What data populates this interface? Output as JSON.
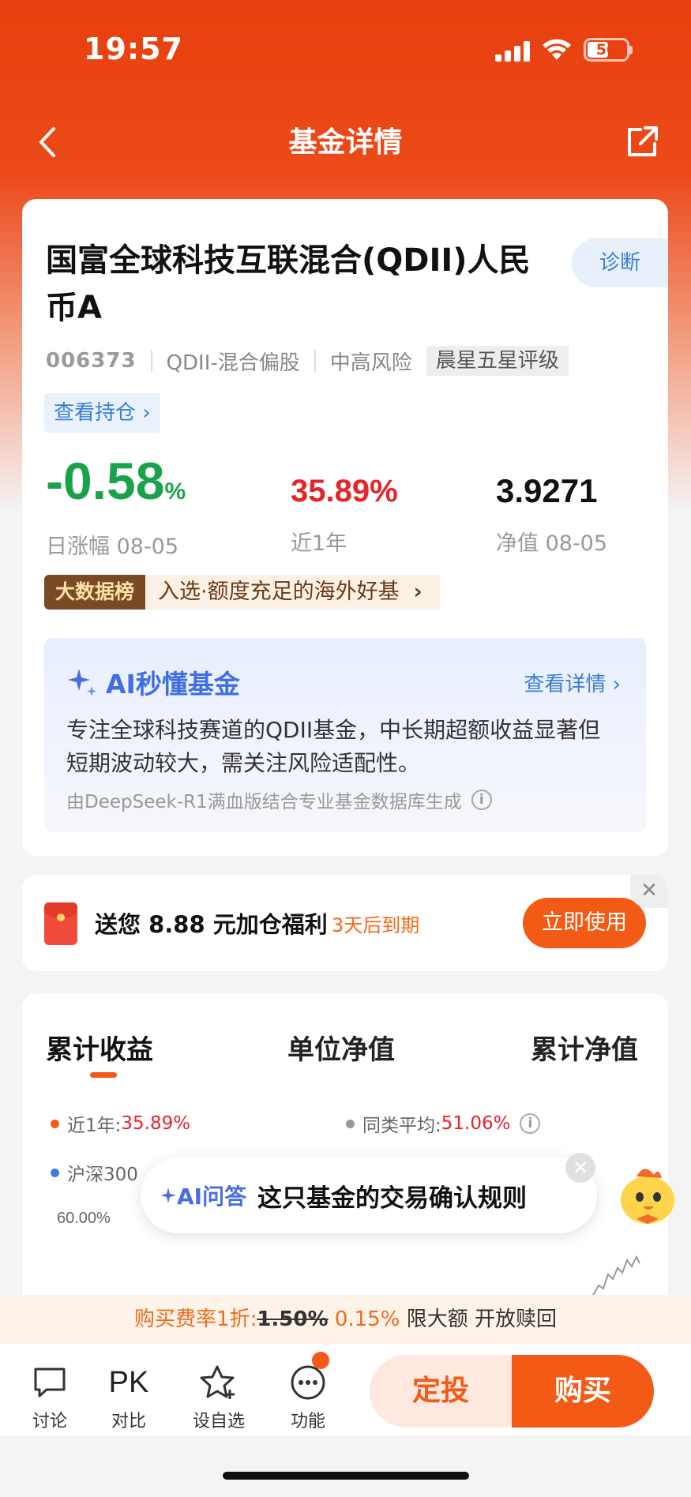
{
  "status_bar": {
    "time": "19:57",
    "battery": "50"
  },
  "nav": {
    "title": "基金详情"
  },
  "fund": {
    "name": "国富全球科技互联混合(QDII)人民币A",
    "diagnose_label": "诊断",
    "code": "006373",
    "type": "QDII-混合偏股",
    "risk": "中高风险",
    "rating": "晨星五星评级",
    "holdings_label": "查看持仓",
    "daily_change": {
      "value": "-0.58",
      "unit": "%",
      "label": "日涨幅 08-05"
    },
    "year_return": {
      "value": "35.89%",
      "label": "近1年"
    },
    "nav_value": {
      "value": "3.9271",
      "label": "净值 08-05"
    },
    "bigdata_tag": "大数据榜",
    "bigdata_text": "入选·额度充足的海外好基"
  },
  "ai_summary": {
    "title": "AI秒懂基金",
    "more": "查看详情",
    "body": "专注全球科技赛道的QDII基金，中长期超额收益显著但短期波动较大，需关注风险适配性。",
    "footnote": "由DeepSeek-R1满血版结合专业基金数据库生成"
  },
  "coupon": {
    "text": "送您 8.88 元加仓福利",
    "expiry": "3天后到期",
    "button": "立即使用"
  },
  "chart_tabs": [
    "累计收益",
    "单位净值",
    "累计净值"
  ],
  "chart_legend": [
    {
      "label": "近1年:",
      "value": "35.89%",
      "color": "#f25a16"
    },
    {
      "label": "同类平均:",
      "value": "51.06%",
      "color": "#999999"
    },
    {
      "label": "沪深300",
      "value": "",
      "color": "#3a7fd5"
    }
  ],
  "chart_data": {
    "type": "line",
    "y_tick_labels": [
      "60.00%"
    ],
    "series": [
      {
        "name": "近1年",
        "values": []
      },
      {
        "name": "同类平均",
        "values": []
      },
      {
        "name": "沪深300",
        "values": []
      }
    ]
  },
  "ai_bubble": {
    "tag": "AI问答",
    "question": "这只基金的交易确认规则"
  },
  "fee": {
    "prefix": "购买费率1折:",
    "original": "1.50%",
    "discount": "0.15%",
    "suffix": "限大额 开放赎回"
  },
  "toolbar": {
    "discuss": "讨论",
    "pk_icon": "PK",
    "compare": "对比",
    "watch": "设自选",
    "function": "功能",
    "auto_invest": "定投",
    "buy": "购买"
  }
}
